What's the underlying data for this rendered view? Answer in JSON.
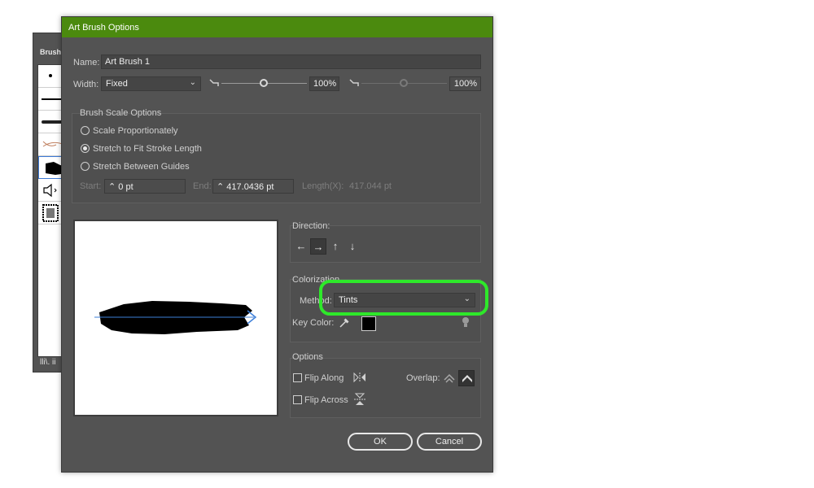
{
  "brushes_panel": {
    "title": "Brushe",
    "bottom_label": "lli\\. ii"
  },
  "dialog": {
    "title": "Art Brush Options",
    "name_label": "Name:",
    "name_value": "Art Brush 1",
    "width_label": "Width:",
    "width_value": "Fixed",
    "width_percent": "100%",
    "width_percent_disabled": "100%",
    "scale_options": {
      "title": "Brush Scale Options",
      "options": [
        "Scale Proportionately",
        "Stretch to Fit Stroke Length",
        "Stretch Between Guides"
      ],
      "selected_index": 1,
      "start_label": "Start:",
      "start_value": "0 pt",
      "end_label": "End:",
      "end_value": "417.0436 pt",
      "length_label": "Length(X):",
      "length_value": "417.044 pt"
    },
    "direction": {
      "title": "Direction:",
      "buttons": [
        "←",
        "→",
        "↑",
        "↓"
      ],
      "selected_index": 1
    },
    "colorization": {
      "title": "Colorization",
      "method_label": "Method:",
      "method_value": "Tints",
      "key_color_label": "Key Color:",
      "key_color": "#000000"
    },
    "options": {
      "title": "Options",
      "flip_along_label": "Flip Along",
      "flip_across_label": "Flip Across",
      "overlap_label": "Overlap:"
    },
    "ok_label": "OK",
    "cancel_label": "Cancel"
  },
  "colors": {
    "titlebar": "#4b8a0e",
    "dialog_bg": "#535353",
    "highlight": "#2ee82a",
    "selection_blue": "#3e7ad6"
  }
}
